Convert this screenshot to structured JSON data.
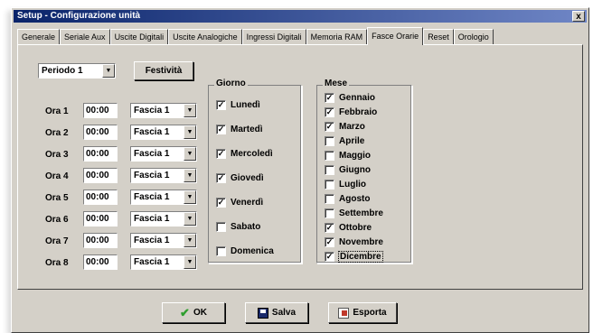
{
  "window": {
    "title": "Setup - Configurazione unità",
    "close_label": "x"
  },
  "tabs": [
    "Generale",
    "Seriale Aux",
    "Uscite Digitali",
    "Uscite Analogiche",
    "Ingressi Digitali",
    "Memoria RAM",
    "Fasce Orarie",
    "Reset",
    "Orologio"
  ],
  "active_tab": "Fasce Orarie",
  "period": {
    "selected": "Periodo 1"
  },
  "festivita_label": "Festività",
  "hours": [
    {
      "label": "Ora 1",
      "time": "00:00",
      "band": "Fascia 1"
    },
    {
      "label": "Ora 2",
      "time": "00:00",
      "band": "Fascia 1"
    },
    {
      "label": "Ora 3",
      "time": "00:00",
      "band": "Fascia 1"
    },
    {
      "label": "Ora 4",
      "time": "00:00",
      "band": "Fascia 1"
    },
    {
      "label": "Ora 5",
      "time": "00:00",
      "band": "Fascia 1"
    },
    {
      "label": "Ora 6",
      "time": "00:00",
      "band": "Fascia 1"
    },
    {
      "label": "Ora 7",
      "time": "00:00",
      "band": "Fascia 1"
    },
    {
      "label": "Ora 8",
      "time": "00:00",
      "band": "Fascia 1"
    }
  ],
  "giorno": {
    "title": "Giorno",
    "days": [
      {
        "label": "Lunedì",
        "checked": true
      },
      {
        "label": "Martedì",
        "checked": true
      },
      {
        "label": "Mercoledì",
        "checked": true
      },
      {
        "label": "Giovedì",
        "checked": true
      },
      {
        "label": "Venerdì",
        "checked": true
      },
      {
        "label": "Sabato",
        "checked": false
      },
      {
        "label": "Domenica",
        "checked": false
      }
    ]
  },
  "mese": {
    "title": "Mese",
    "months": [
      {
        "label": "Gennaio",
        "checked": true
      },
      {
        "label": "Febbraio",
        "checked": true
      },
      {
        "label": "Marzo",
        "checked": true
      },
      {
        "label": "Aprile",
        "checked": false
      },
      {
        "label": "Maggio",
        "checked": false
      },
      {
        "label": "Giugno",
        "checked": false
      },
      {
        "label": "Luglio",
        "checked": false
      },
      {
        "label": "Agosto",
        "checked": false
      },
      {
        "label": "Settembre",
        "checked": false
      },
      {
        "label": "Ottobre",
        "checked": true
      },
      {
        "label": "Novembre",
        "checked": true
      },
      {
        "label": "Dicembre",
        "checked": true
      }
    ]
  },
  "buttons": {
    "ok": "OK",
    "salva": "Salva",
    "esporta": "Esporta"
  },
  "colors": {
    "title_start": "#0a246a",
    "title_end": "#6f86c6",
    "face": "#d4d0c8",
    "ok_check": "#2e9e2e",
    "export_icon": "#c0392b"
  }
}
